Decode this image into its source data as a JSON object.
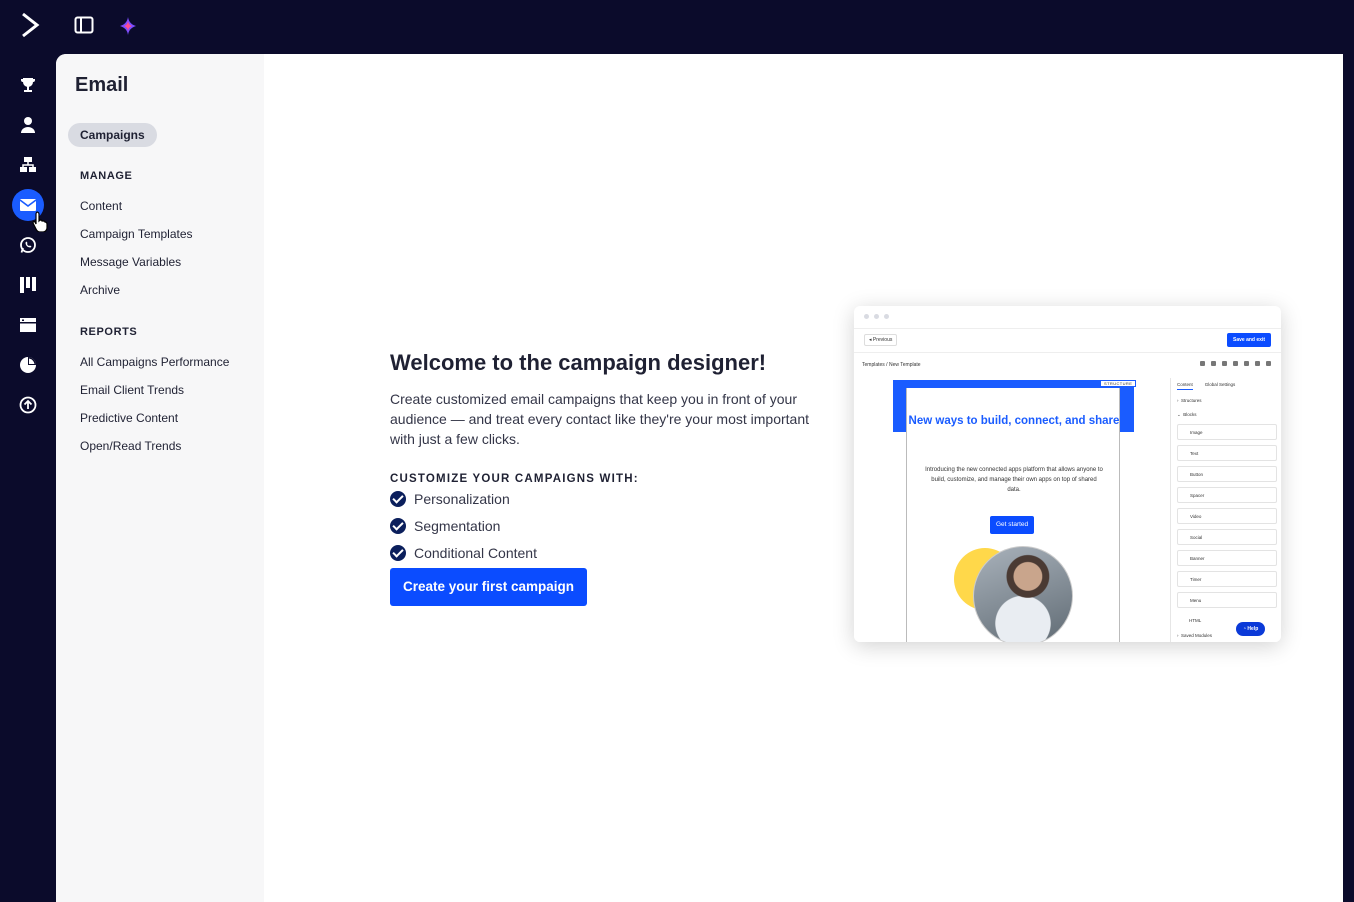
{
  "topbar": {
    "logo": "activecampaign-logo",
    "toggle_icon": "sidebar-toggle-icon",
    "ai_icon": "sparkle-icon"
  },
  "rail": {
    "items": [
      {
        "name": "trophy-icon"
      },
      {
        "name": "contacts-icon"
      },
      {
        "name": "automations-icon"
      },
      {
        "name": "email-icon",
        "active": true
      },
      {
        "name": "whatsapp-icon"
      },
      {
        "name": "pipeline-icon"
      },
      {
        "name": "site-icon"
      },
      {
        "name": "reports-icon"
      },
      {
        "name": "upload-icon"
      }
    ]
  },
  "secnav": {
    "title": "Email",
    "active_pill": "Campaigns",
    "manage_heading": "MANAGE",
    "manage_items": [
      "Content",
      "Campaign Templates",
      "Message Variables",
      "Archive"
    ],
    "reports_heading": "REPORTS",
    "reports_items": [
      "All Campaigns Performance",
      "Email Client Trends",
      "Predictive Content",
      "Open/Read Trends"
    ]
  },
  "welcome": {
    "title": "Welcome to the campaign designer!",
    "description": "Create customized email campaigns that keep you in front of your audience — and treat every contact like they're your most important with just a few clicks.",
    "subheading": "CUSTOMIZE YOUR CAMPAIGNS WITH:",
    "features": [
      "Personalization",
      "Segmentation",
      "Conditional Content"
    ],
    "cta": "Create your first campaign"
  },
  "preview": {
    "previous": "Previous",
    "save": "Save and exit",
    "breadcrumb": "Templates / New Template",
    "structure_tag": "STRUCTURE",
    "headline": "New ways to build, connect, and share",
    "body": "Introducing the new connected apps platform that allows anyone to build, customize, and manage their own apps on top of shared data.",
    "button": "Get started",
    "tabs": [
      "Content",
      "Global Settings"
    ],
    "structures": "Structures",
    "blocks_label": "Blocks",
    "blocks": [
      "Image",
      "Text",
      "Button",
      "Spacer",
      "Video",
      "Social",
      "Banner",
      "Timer",
      "Menu",
      "HTML"
    ],
    "saved_modules": "Saved Modules",
    "help": "Help"
  },
  "colors": {
    "nav_bg": "#0b0b2b",
    "accent": "#0b4cff",
    "active_icon": "#1a5cff"
  }
}
